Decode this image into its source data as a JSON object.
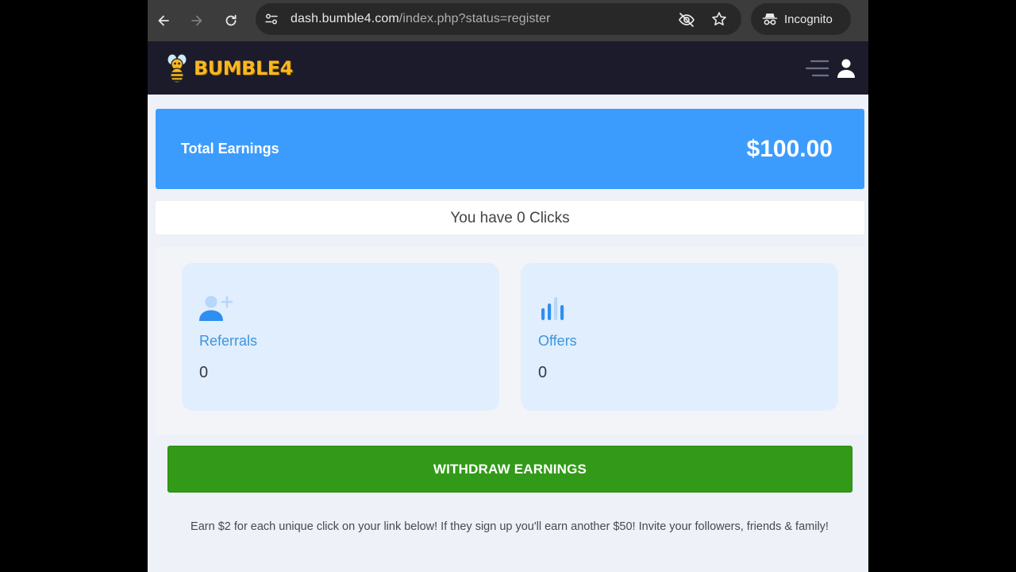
{
  "browser": {
    "url_domain": "dash.bumble4.com",
    "url_path": "/index.php?status=register",
    "incognito_label": "Incognito",
    "icons": [
      "back-arrow-icon",
      "forward-arrow-icon",
      "reload-icon",
      "site-settings-icon",
      "eye-off-icon",
      "star-icon",
      "incognito-icon"
    ]
  },
  "header": {
    "logo_text": "BUMBLE4",
    "icons": [
      "bee-icon",
      "menu-icon",
      "user-icon"
    ],
    "colors": {
      "background": "#1c1b2b",
      "logo": "#f9b820"
    }
  },
  "earnings": {
    "label": "Total Earnings",
    "value": "$100.00",
    "color": "#3c9cfe"
  },
  "clicks": {
    "text": "You have 0 Clicks"
  },
  "stats": [
    {
      "label": "Referrals",
      "value": "0",
      "icon": "add-user-icon"
    },
    {
      "label": "Offers",
      "value": "0",
      "icon": "bar-chart-icon"
    }
  ],
  "withdraw": {
    "label": "WITHDRAW EARNINGS",
    "color": "#329a18"
  },
  "invite": {
    "text": "Earn $2 for each unique click on your link below! If they sign up you'll earn another $50! Invite your followers, friends & family!"
  }
}
